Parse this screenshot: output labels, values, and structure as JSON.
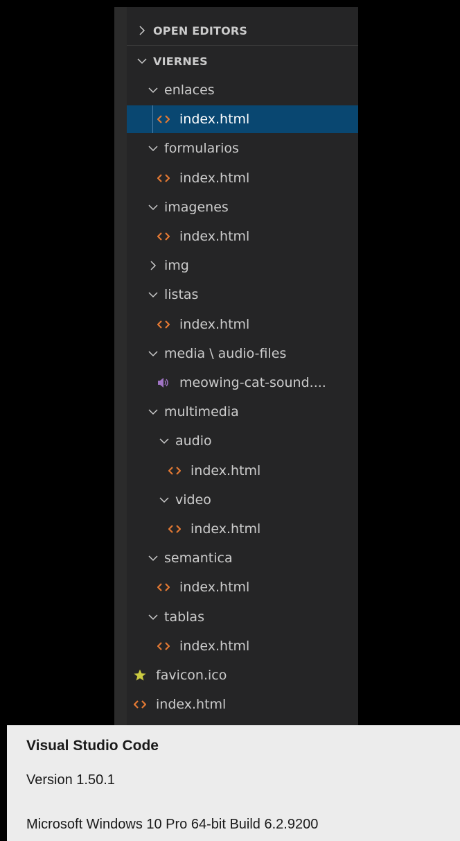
{
  "explorer": {
    "sections": {
      "open_editors": "OPEN EDITORS",
      "workspace": "VIERNES"
    },
    "items": [
      {
        "label": "enlaces",
        "type": "folder",
        "expanded": true
      },
      {
        "label": "index.html",
        "type": "html",
        "selected": true
      },
      {
        "label": "formularios",
        "type": "folder",
        "expanded": true
      },
      {
        "label": "index.html",
        "type": "html"
      },
      {
        "label": "imagenes",
        "type": "folder",
        "expanded": true
      },
      {
        "label": "index.html",
        "type": "html"
      },
      {
        "label": "img",
        "type": "folder",
        "expanded": false
      },
      {
        "label": "listas",
        "type": "folder",
        "expanded": true
      },
      {
        "label": "index.html",
        "type": "html"
      },
      {
        "label": "media \\ audio-files",
        "type": "folder",
        "expanded": true
      },
      {
        "label": "meowing-cat-sound....",
        "type": "audio"
      },
      {
        "label": "multimedia",
        "type": "folder",
        "expanded": true
      },
      {
        "label": "audio",
        "type": "folder",
        "expanded": true
      },
      {
        "label": "index.html",
        "type": "html"
      },
      {
        "label": "video",
        "type": "folder",
        "expanded": true
      },
      {
        "label": "index.html",
        "type": "html"
      },
      {
        "label": "semantica",
        "type": "folder",
        "expanded": true
      },
      {
        "label": "index.html",
        "type": "html"
      },
      {
        "label": "tablas",
        "type": "folder",
        "expanded": true
      },
      {
        "label": "index.html",
        "type": "html"
      },
      {
        "label": "favicon.ico",
        "type": "favicon"
      },
      {
        "label": "index.html",
        "type": "html"
      }
    ]
  },
  "about": {
    "app_name": "Visual Studio Code",
    "version": "Version 1.50.1",
    "os": "Microsoft Windows 10 Pro 64-bit Build 6.2.9200"
  },
  "colors": {
    "sidebar_bg": "#252526",
    "selection_bg": "#094771",
    "html_icon": "#e37933",
    "audio_icon": "#a074c4",
    "favicon_icon": "#cbcb41"
  }
}
